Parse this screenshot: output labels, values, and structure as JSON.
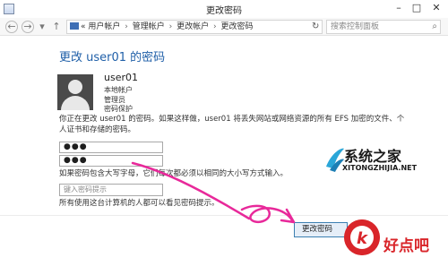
{
  "window": {
    "title": "更改密码",
    "minimize": "–",
    "maximize": "□",
    "close": "✕"
  },
  "addressbar": {
    "back": "←",
    "forward": "→",
    "dropdown": "▾",
    "up": "↑",
    "breadcrumb": [
      "用户帐户",
      "管理帐户",
      "更改帐户",
      "更改密码"
    ],
    "separator": "›",
    "overflow": "«",
    "refresh": "↻",
    "search_placeholder": "搜索控制面板",
    "search_icon": "⌕"
  },
  "content": {
    "heading": "更改 user01 的密码",
    "user": {
      "name": "user01",
      "lines": [
        "本地帐户",
        "管理员",
        "密码保护"
      ]
    },
    "description": "你正在更改 user01 的密码。如果这样做，user01 将丢失网站或网络资源的所有 EFS 加密的文件、个人证书和存储的密码。",
    "new_password_value": "●●●",
    "confirm_password_value": "●●●",
    "case_note": "如果密码包含大写字母，它们每次都必须以相同的大小写方式输入。",
    "hint_placeholder": "键入密码提示",
    "hint_note": "所有使用这台计算机的人都可以看见密码提示。",
    "change_button": "更改密码"
  },
  "watermarks": {
    "site1_name": "系统之家",
    "site1_domain": "XITONGZHIJIA.NET",
    "site2_name": "好点吧",
    "site2_mark": "k"
  },
  "colors": {
    "accent": "#1f5fa8",
    "annotation": "#e8299a",
    "brand_red": "#d9252a"
  }
}
